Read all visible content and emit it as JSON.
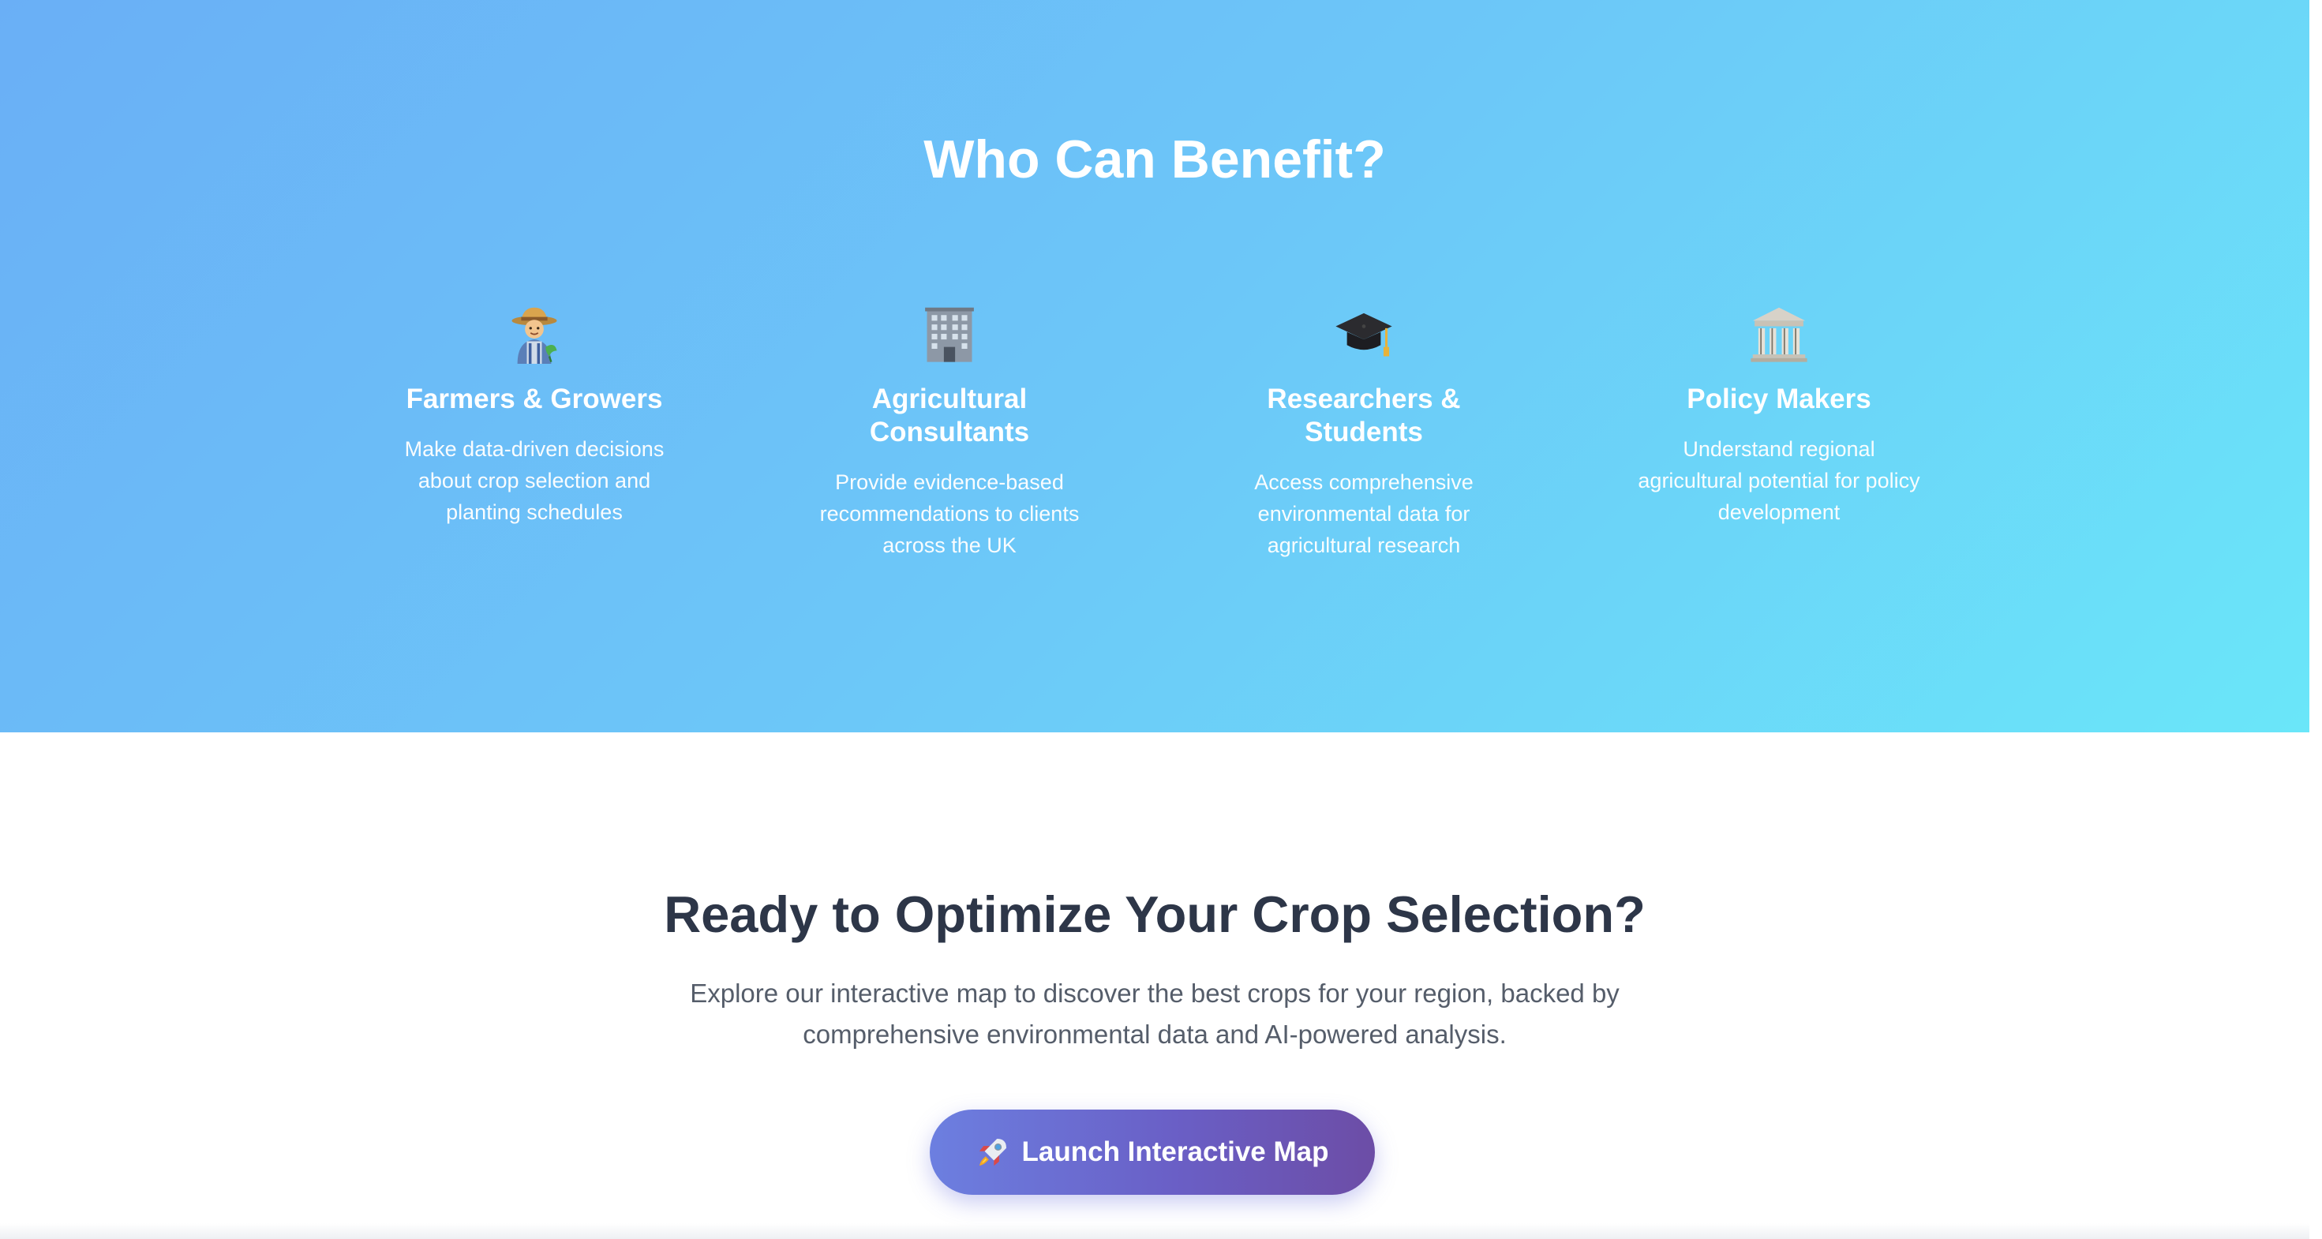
{
  "benefit_section": {
    "title": "Who Can Benefit?",
    "cards": [
      {
        "icon": "farmer-icon",
        "title": "Farmers & Growers",
        "description": "Make data-driven decisions about crop selection and planting schedules"
      },
      {
        "icon": "office-building-icon",
        "title": "Agricultural Consultants",
        "description": "Provide evidence-based recommendations to clients across the UK"
      },
      {
        "icon": "graduation-cap-icon",
        "title": "Researchers & Students",
        "description": "Access comprehensive environmental data for agricultural research"
      },
      {
        "icon": "classical-building-icon",
        "title": "Policy Makers",
        "description": "Understand regional agricultural potential for policy development"
      }
    ]
  },
  "cta_section": {
    "title": "Ready to Optimize Your Crop Selection?",
    "text": "Explore our interactive map to discover the best crops for your region, backed by comprehensive environmental data and AI-powered analysis.",
    "button": {
      "icon": "rocket-icon",
      "label": "Launch Interactive Map"
    }
  },
  "colors": {
    "gradient_start": "#6aaff6",
    "gradient_end": "#6ae6f9",
    "heading_dark": "#2d3648",
    "body_gray": "#555d6a",
    "button_start": "#6c7fe0",
    "button_end": "#6c4da6"
  }
}
